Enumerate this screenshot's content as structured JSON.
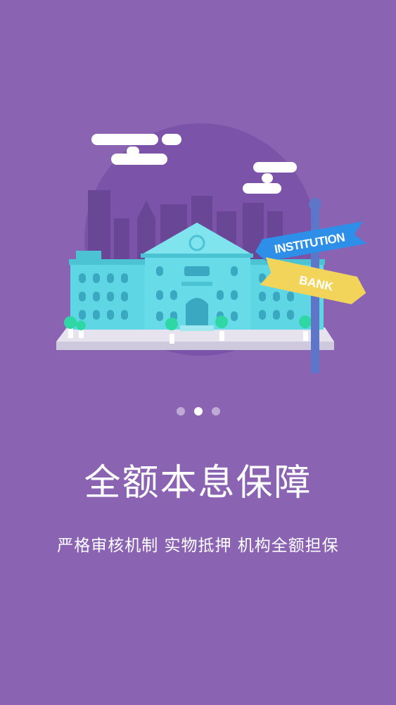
{
  "slide": {
    "illustration": {
      "name": "bank-institution-illustration",
      "signs": {
        "institution": "INSTITUTION",
        "bank": "BANK"
      },
      "colors": {
        "background": "#8b63b3",
        "circle": "#7b53a9",
        "skyline": "#6a4696",
        "building": "#5fd6e3",
        "sign_blue": "#2d8fe8",
        "sign_yellow": "#f2d45a"
      }
    },
    "pager": {
      "total": 3,
      "active_index": 1
    },
    "title": "全额本息保障",
    "subtitle": "严格审核机制 实物抵押 机构全额担保"
  }
}
